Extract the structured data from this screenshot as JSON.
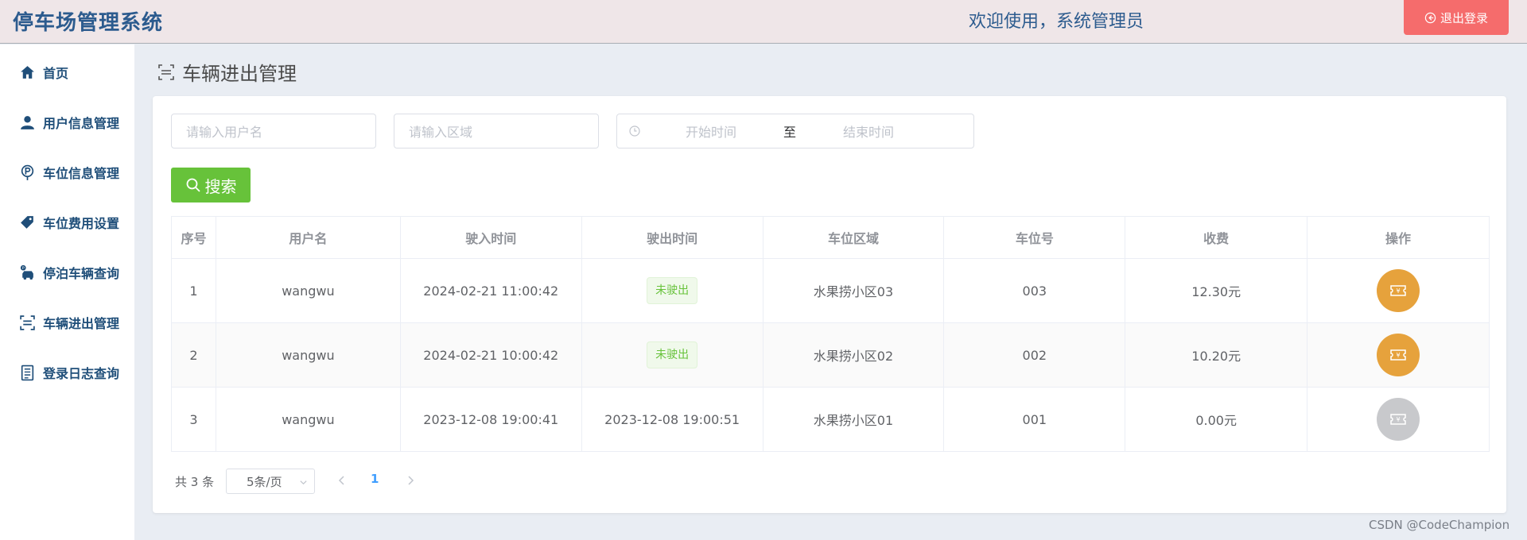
{
  "header": {
    "app_title": "停车场管理系统",
    "welcome": "欢迎使用，系统管理员",
    "logout_label": "退出登录"
  },
  "sidebar": {
    "items": [
      {
        "label": "首页",
        "icon": "home-icon"
      },
      {
        "label": "用户信息管理",
        "icon": "user-icon"
      },
      {
        "label": "车位信息管理",
        "icon": "parking-icon"
      },
      {
        "label": "车位费用设置",
        "icon": "price-tag-icon"
      },
      {
        "label": "停泊车辆查询",
        "icon": "car-icon"
      },
      {
        "label": "车辆进出管理",
        "icon": "scan-icon"
      },
      {
        "label": "登录日志查询",
        "icon": "notebook-icon"
      }
    ]
  },
  "main": {
    "page_title": "车辆进出管理",
    "filters": {
      "username_placeholder": "请输入用户名",
      "area_placeholder": "请输入区域",
      "start_placeholder": "开始时间",
      "range_separator": "至",
      "end_placeholder": "结束时间"
    },
    "search_label": "搜索",
    "table": {
      "columns": [
        "序号",
        "用户名",
        "驶入时间",
        "驶出时间",
        "车位区域",
        "车位号",
        "收费",
        "操作"
      ],
      "rows": [
        {
          "no": "1",
          "username": "wangwu",
          "enter_time": "2024-02-21 11:00:42",
          "exit_time": "未驶出",
          "area": "水果捞小区03",
          "space_no": "003",
          "fee": "12.30元",
          "fee_color": "#e4161d",
          "action_enabled": true
        },
        {
          "no": "2",
          "username": "wangwu",
          "enter_time": "2024-02-21 10:00:42",
          "exit_time": "未驶出",
          "area": "水果捞小区02",
          "space_no": "002",
          "fee": "10.20元",
          "fee_color": "#e4161d",
          "action_enabled": true
        },
        {
          "no": "3",
          "username": "wangwu",
          "enter_time": "2023-12-08 19:00:41",
          "exit_time": "2023-12-08 19:00:51",
          "area": "水果捞小区01",
          "space_no": "001",
          "fee": "0.00元",
          "fee_color": "#606266",
          "action_enabled": false
        }
      ]
    },
    "pagination": {
      "total": "共 3 条",
      "page_size": "5条/页",
      "current_page": "1"
    }
  },
  "watermark": "CSDN @CodeChampion",
  "colors": {
    "primary_text": "#2c5b8e",
    "logout_bg": "#f56c6c",
    "search_bg": "#67c23a",
    "action_bg": "#e6a23c",
    "fee_unpaid": "#e4161d"
  }
}
